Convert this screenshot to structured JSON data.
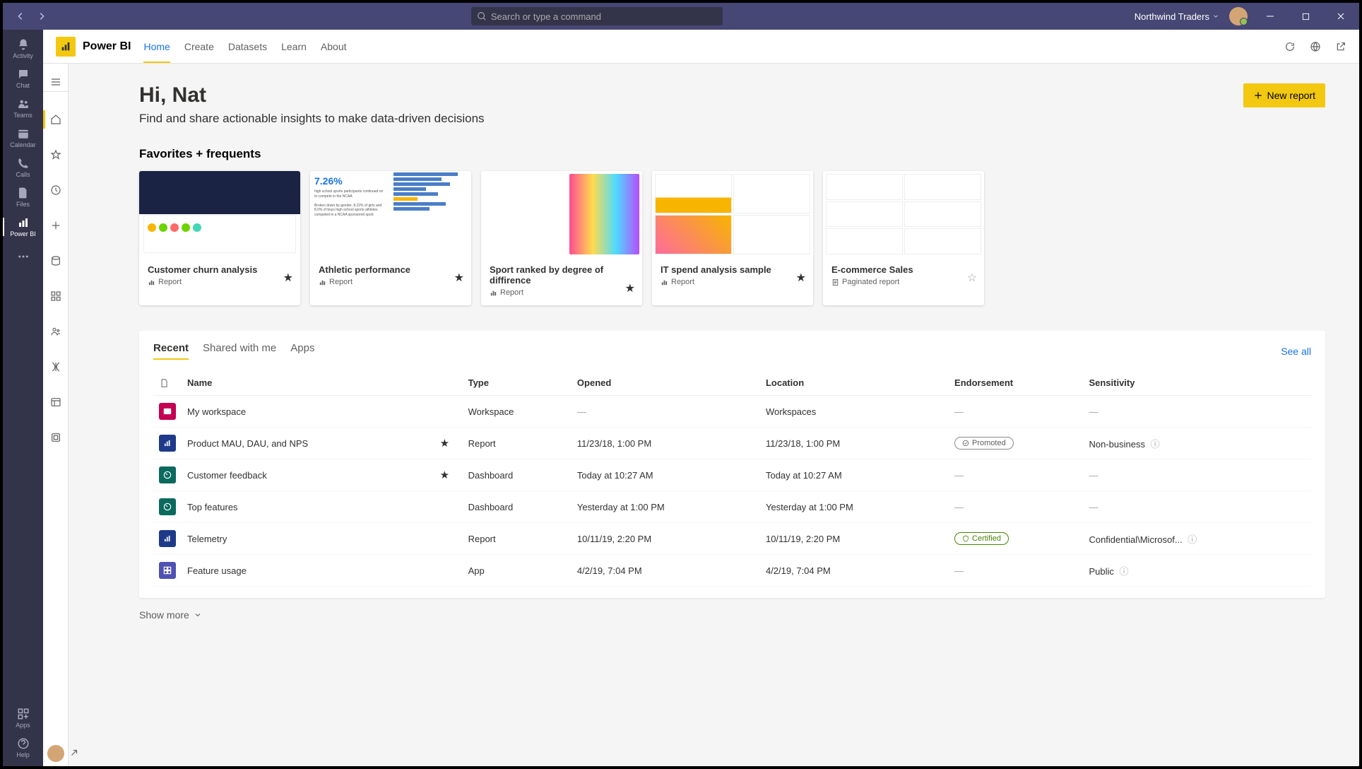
{
  "titlebar": {
    "search_placeholder": "Search or type a command",
    "org": "Northwind Traders"
  },
  "rail": {
    "items": [
      {
        "label": "Activity"
      },
      {
        "label": "Chat"
      },
      {
        "label": "Teams"
      },
      {
        "label": "Calendar"
      },
      {
        "label": "Calls"
      },
      {
        "label": "Files"
      },
      {
        "label": "Power BI"
      }
    ],
    "apps_label": "Apps",
    "help_label": "Help"
  },
  "pbiHeader": {
    "brand": "Power BI",
    "tabs": [
      "Home",
      "Create",
      "Datasets",
      "Learn",
      "About"
    ]
  },
  "hero": {
    "greeting": "Hi, Nat",
    "subtitle": "Find and share actionable insights to make data-driven decisions",
    "new_report": "New report"
  },
  "fav_section": "Favorites + frequents",
  "cards": [
    {
      "title": "Customer churn analysis",
      "type": "Report",
      "fav": true
    },
    {
      "title": "Athletic performance",
      "type": "Report",
      "fav": true,
      "stat": "7.26%"
    },
    {
      "title": "Sport ranked by degree of diffirence",
      "type": "Report",
      "fav": true
    },
    {
      "title": "IT spend analysis sample",
      "type": "Report",
      "fav": true
    },
    {
      "title": "E-commerce Sales",
      "type": "Paginated report",
      "fav": false
    }
  ],
  "recent": {
    "tabs": [
      "Recent",
      "Shared with me",
      "Apps"
    ],
    "see_all": "See all",
    "columns": [
      "",
      "Name",
      "",
      "Type",
      "Opened",
      "Location",
      "Endorsement",
      "Sensitivity"
    ],
    "rows": [
      {
        "ico": "ws",
        "name": "My workspace",
        "star": "",
        "type": "Workspace",
        "opened": "—",
        "location": "Workspaces",
        "endorsement": "—",
        "sensitivity": "—"
      },
      {
        "ico": "rep",
        "name": "Product MAU, DAU, and NPS",
        "star": "★",
        "type": "Report",
        "opened": "11/23/18, 1:00 PM",
        "location": "11/23/18, 1:00 PM",
        "endorsement": "Promoted",
        "sensitivity": "Non-business",
        "info": true
      },
      {
        "ico": "dash",
        "name": "Customer feedback",
        "star": "★",
        "type": "Dashboard",
        "opened": "Today at 10:27 AM",
        "location": "Today at 10:27 AM",
        "endorsement": "—",
        "sensitivity": "—"
      },
      {
        "ico": "dash",
        "name": "Top features",
        "star": "",
        "type": "Dashboard",
        "opened": "Yesterday at 1:00 PM",
        "location": "Yesterday at 1:00 PM",
        "endorsement": "—",
        "sensitivity": "—"
      },
      {
        "ico": "rep",
        "name": "Telemetry",
        "star": "",
        "type": "Report",
        "opened": "10/11/19, 2:20 PM",
        "location": "10/11/19, 2:20 PM",
        "endorsement": "Certified",
        "sensitivity": "Confidential\\Microsof...",
        "info": true
      },
      {
        "ico": "app",
        "name": "Feature usage",
        "star": "",
        "type": "App",
        "opened": "4/2/19, 7:04 PM",
        "location": "4/2/19, 7:04 PM",
        "endorsement": "—",
        "sensitivity": "Public",
        "info": true
      }
    ],
    "show_more": "Show more"
  }
}
